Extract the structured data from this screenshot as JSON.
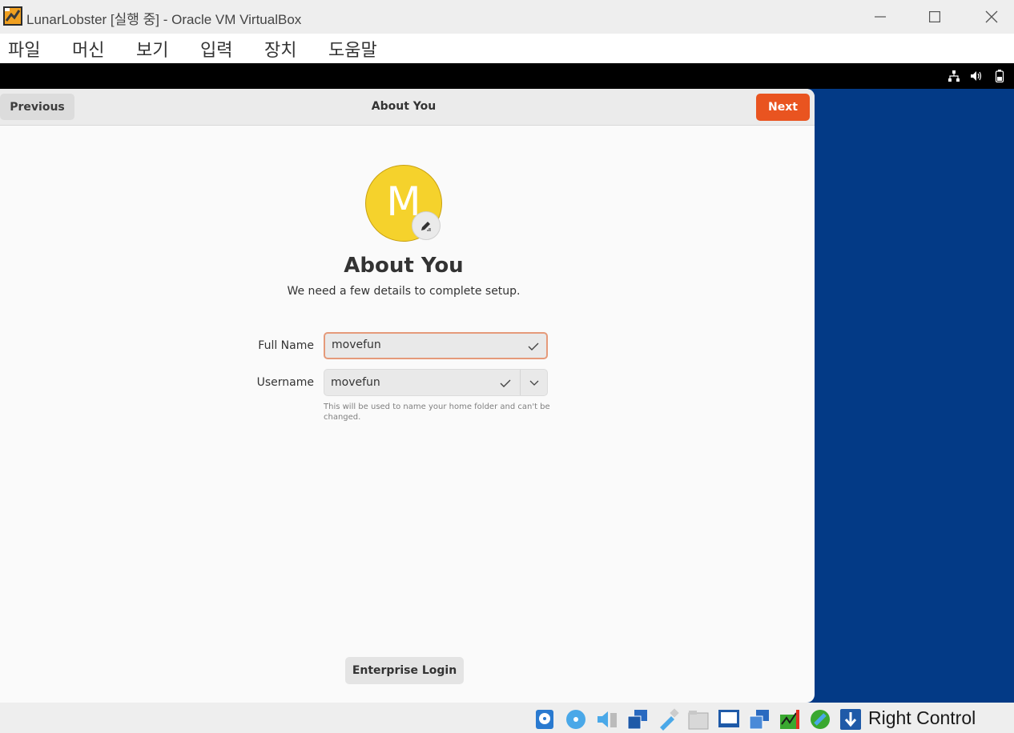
{
  "window": {
    "title": "LunarLobster [실행 중] - Oracle VM VirtualBox"
  },
  "menubar": {
    "items": [
      "파일",
      "머신",
      "보기",
      "입력",
      "장치",
      "도움말"
    ]
  },
  "vm_tray": {
    "icons": [
      "network-icon",
      "volume-icon",
      "battery-icon"
    ]
  },
  "installer": {
    "previous_label": "Previous",
    "header_title": "About You",
    "next_label": "Next",
    "accent_color": "#e95420",
    "avatar_initial": "M",
    "avatar_color": "#f5d22c",
    "heading": "About You",
    "subtitle": "We need a few details to complete setup.",
    "fullname_label": "Full Name",
    "fullname_value": "movefun",
    "username_label": "Username",
    "username_value": "movefun",
    "username_help": "This will be used to name your home folder and can't be changed.",
    "enterprise_label": "Enterprise Login"
  },
  "statusbar": {
    "icons": [
      "hard-disk-icon",
      "optical-drive-icon",
      "audio-icon",
      "network-adapter-icon",
      "usb-icon",
      "shared-folders-icon",
      "display-icon",
      "capture-icon",
      "cpu-activity-icon",
      "mouse-integration-icon",
      "keyboard-capture-icon"
    ],
    "host_key": "Right Control"
  }
}
